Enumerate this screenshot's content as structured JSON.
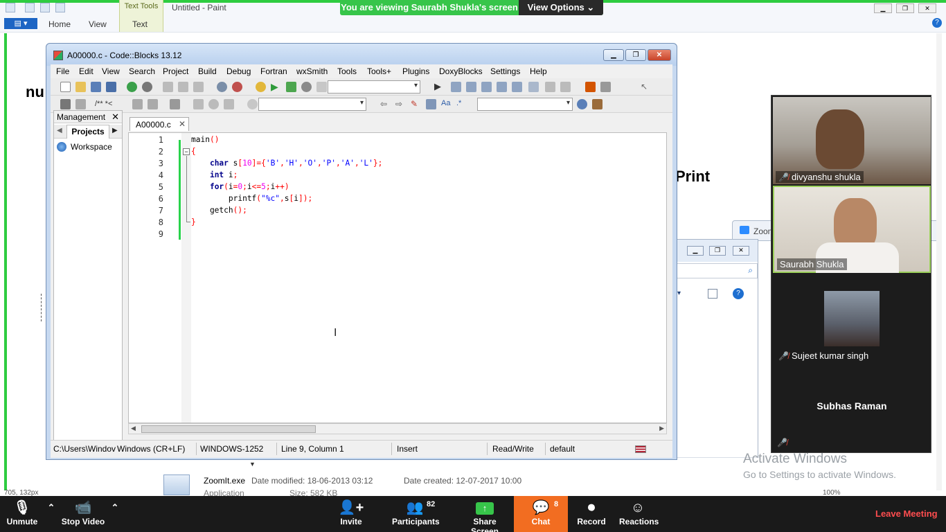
{
  "paint": {
    "title": "Untitled - Paint",
    "context_group": "Text Tools",
    "tabs": [
      "Home",
      "View",
      "Text"
    ],
    "canvas_text_1": "nu",
    "canvas_text_2": "Print",
    "status_left": "705, 132px",
    "zoom_level": "100%"
  },
  "banner": {
    "text": "You are viewing Saurabh Shukla's screen",
    "options": "View Options"
  },
  "explorer": {
    "tab_label": "Zoom",
    "file_name": "ZoomIt.exe",
    "modified_label": "Date modified: 18-06-2013 03:12",
    "created_label": "Date created: 12-07-2017 10:00",
    "type": "Application",
    "size": "Size: 582 KB"
  },
  "codeblocks": {
    "title": "A00000.c - Code::Blocks 13.12",
    "menu": [
      "File",
      "Edit",
      "View",
      "Search",
      "Project",
      "Build",
      "Debug",
      "Fortran",
      "wxSmith",
      "Tools",
      "Tools+",
      "Plugins",
      "DoxyBlocks",
      "Settings",
      "Help"
    ],
    "management": {
      "title": "Management",
      "tab": "Projects",
      "workspace": "Workspace"
    },
    "editor_tab": "A00000.c",
    "line_numbers": [
      "1",
      "2",
      "3",
      "4",
      "5",
      "6",
      "7",
      "8",
      "9"
    ],
    "status": {
      "path": "C:\\Users\\Windov",
      "eol": "Windows (CR+LF)",
      "encoding": "WINDOWS-1252",
      "position": "Line 9, Column 1",
      "mode": "Insert",
      "access": "Read/Write",
      "lang": "default"
    }
  },
  "participants": [
    {
      "name": "divyanshu shukla",
      "muted": true
    },
    {
      "name": "Saurabh Shukla",
      "muted": false
    },
    {
      "name": "Sujeet kumar singh",
      "muted": true
    },
    {
      "name": "Subhas Raman",
      "muted": true
    }
  ],
  "watermark": {
    "line1": "Activate Windows",
    "line2": "Go to Settings to activate Windows."
  },
  "zoom_toolbar": {
    "unmute": "Unmute",
    "stop_video": "Stop Video",
    "invite": "Invite",
    "participants": "Participants",
    "participants_count": "82",
    "share_screen": "Share Screen",
    "chat": "Chat",
    "chat_count": "8",
    "record": "Record",
    "reactions": "Reactions",
    "leave": "Leave Meeting"
  },
  "colors": {
    "share_green": "#37c54a",
    "chat_orange": "#f26d21",
    "leave_red": "#ff4d4f"
  }
}
